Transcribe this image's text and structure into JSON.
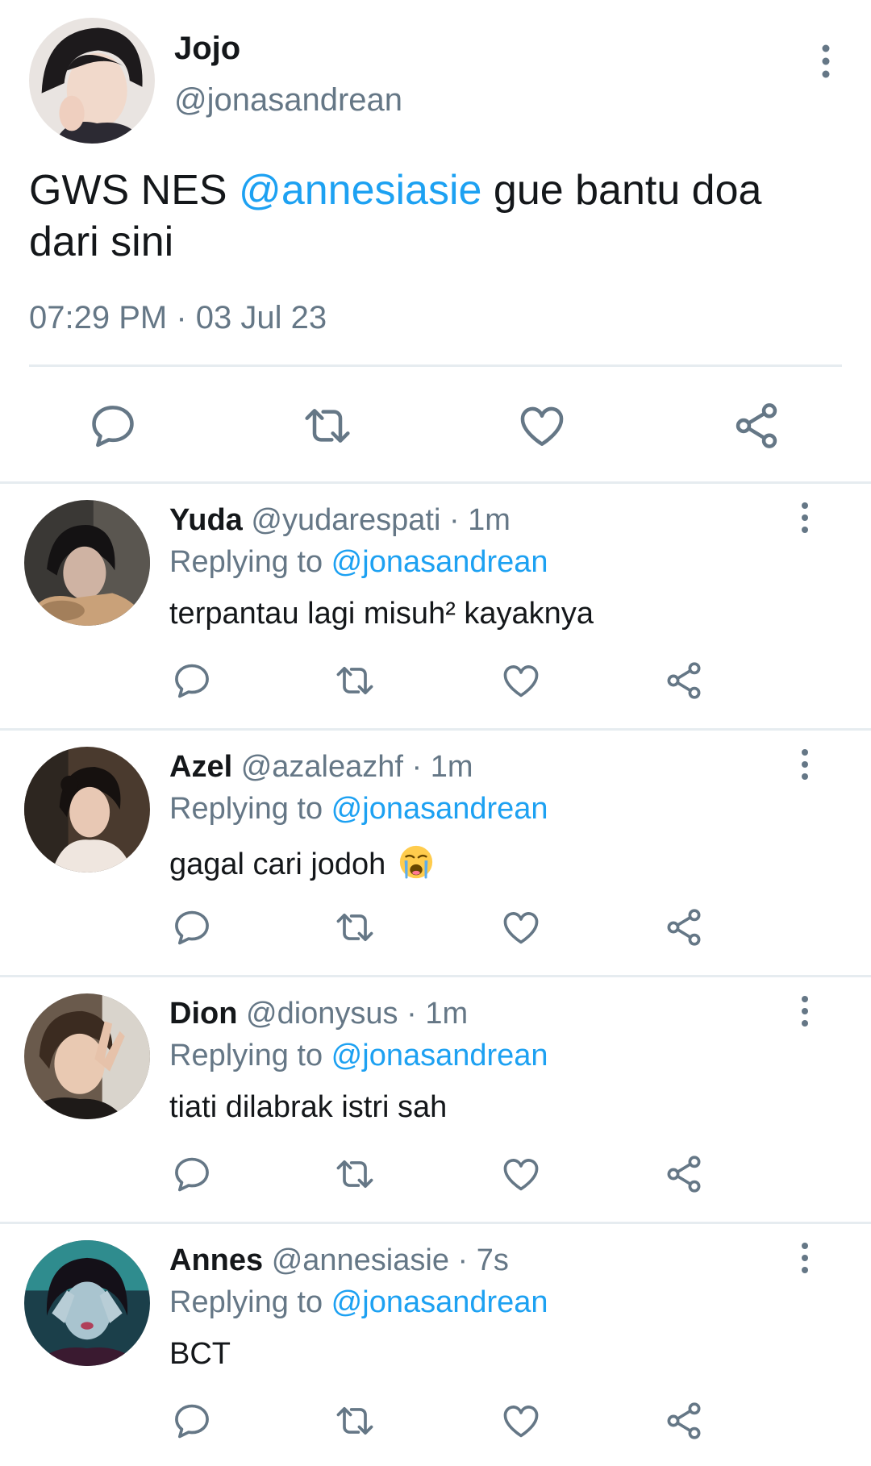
{
  "tweet": {
    "name": "Jojo",
    "handle": "@jonasandrean",
    "text_before": "GWS NES ",
    "mention": "@annesiasie",
    "text_after": " gue bantu doa dari sini",
    "timestamp": "07:29 PM · 03 Jul 23",
    "actions": [
      "reply-icon",
      "retweet-icon",
      "like-icon",
      "share-icon"
    ]
  },
  "replies": [
    {
      "name": "Yuda",
      "meta": " @yudarespati · 1m",
      "replying_label": "Replying to ",
      "replying_to": "@jonasandrean",
      "text": "terpantau lagi misuh² kayaknya"
    },
    {
      "name": "Azel",
      "meta": " @azaleazhf · 1m",
      "replying_label": "Replying to ",
      "replying_to": "@jonasandrean",
      "text": "gagal cari jodoh ",
      "emoji": "loudly-crying-face-icon"
    },
    {
      "name": "Dion",
      "meta": " @dionysus · 1m",
      "replying_label": "Replying to ",
      "replying_to": "@jonasandrean",
      "text": "tiati dilabrak istri sah"
    },
    {
      "name": "Annes",
      "meta": " @annesiasie · 7s",
      "replying_label": "Replying to ",
      "replying_to": "@jonasandrean",
      "text": "BCT"
    }
  ],
  "colors": {
    "link": "#1da1f2",
    "secondary_text": "#657786",
    "icon": "#657786",
    "divider": "#e6ecf0"
  }
}
